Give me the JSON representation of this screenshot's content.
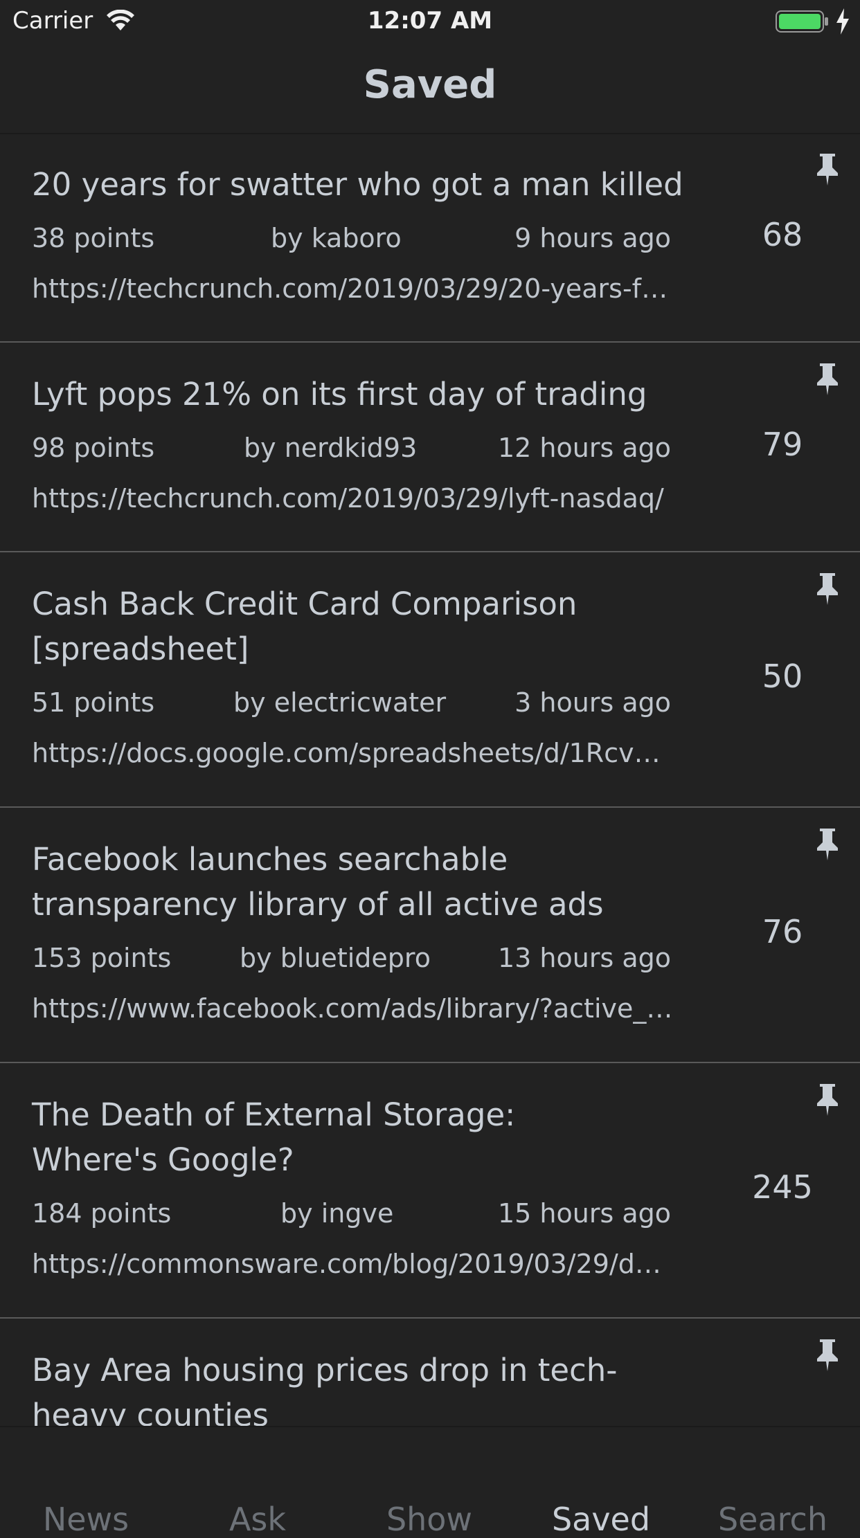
{
  "status_bar": {
    "carrier": "Carrier",
    "time": "12:07 AM",
    "battery_color": "#4cd964",
    "text_color": "#f0f0f0"
  },
  "nav": {
    "title": "Saved"
  },
  "stories": [
    {
      "title": "20 years for swatter who got a man killed",
      "points": "38 points",
      "author": "by kaboro",
      "time": "9 hours ago",
      "url": "https://techcrunch.com/2019/03/29/20-years-fo…",
      "comments": "68",
      "icon": "pin-icon"
    },
    {
      "title": "Lyft pops 21% on its first day of trading",
      "points": "98 points",
      "author": "by nerdkid93",
      "time": "12 hours ago",
      "url": "https://techcrunch.com/2019/03/29/lyft-nasdaq/",
      "comments": "79",
      "icon": "pin-icon"
    },
    {
      "title": "Cash Back Credit Card Comparison [spreadsheet]",
      "points": "51 points",
      "author": "by electricwater",
      "time": "3 hours ago",
      "url": "https://docs.google.com/spreadsheets/d/1Rcv…",
      "comments": "50",
      "icon": "pin-icon"
    },
    {
      "title": "Facebook launches searchable transparency library of all active ads",
      "points": "153 points",
      "author": "by bluetidepro",
      "time": "13 hours ago",
      "url": "https://www.facebook.com/ads/library/?active_…",
      "comments": "76",
      "icon": "pin-icon"
    },
    {
      "title": "The Death of External Storage: Where's Google?",
      "points": "184 points",
      "author": "by ingve",
      "time": "15 hours ago",
      "url": "https://commonsware.com/blog/2019/03/29/d…",
      "comments": "245",
      "icon": "pin-icon"
    },
    {
      "title": "Bay Area housing prices drop in tech-heavy counties",
      "icon": "pin-icon"
    }
  ],
  "tabs": [
    {
      "label": "News",
      "active": false
    },
    {
      "label": "Ask",
      "active": false
    },
    {
      "label": "Show",
      "active": false
    },
    {
      "label": "Saved",
      "active": true
    },
    {
      "label": "Search",
      "active": false
    }
  ],
  "colors": {
    "background": "#222222",
    "text": "#c9cfd6",
    "separator": "#5a5a5a",
    "tab_inactive": "#6d7278"
  }
}
